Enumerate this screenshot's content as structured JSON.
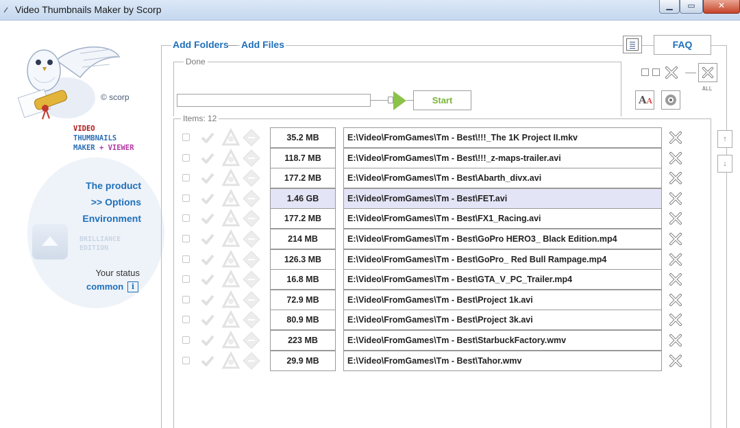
{
  "window": {
    "title": "Video Thumbnails Maker by Scorp"
  },
  "sidebar": {
    "copyright": "© scorp",
    "brand": {
      "line1": "VIDEO",
      "line2": "THUMBNAILS",
      "line3a": "MAKER",
      "line3b": "+",
      "line3c": "VIEWER"
    },
    "nav": [
      {
        "label": "The product"
      },
      {
        "label": ">> Options"
      },
      {
        "label": "Environment"
      }
    ],
    "edition": {
      "line1": "BRILLIANCE",
      "line2": "EDITION"
    },
    "status": {
      "label": "Your status",
      "value": "common"
    }
  },
  "toolbar": {
    "add_folders": "Add Folders",
    "add_files": "Add Files",
    "faq": "FAQ",
    "all_label": "ALL"
  },
  "progress": {
    "label": "Done",
    "value": 0,
    "start_button": "Start"
  },
  "items": {
    "label": "Items: 12",
    "rows": [
      {
        "size": "35.2 MB",
        "path": "E:\\Video\\FromGames\\Tm - Best\\!!!_The 1K Project II.mkv",
        "selected": false
      },
      {
        "size": "118.7 MB",
        "path": "E:\\Video\\FromGames\\Tm - Best\\!!!_z-maps-trailer.avi",
        "selected": false
      },
      {
        "size": "177.2 MB",
        "path": "E:\\Video\\FromGames\\Tm - Best\\Abarth_divx.avi",
        "selected": false
      },
      {
        "size": "1.46 GB",
        "path": "E:\\Video\\FromGames\\Tm - Best\\FET.avi",
        "selected": true
      },
      {
        "size": "177.2 MB",
        "path": "E:\\Video\\FromGames\\Tm - Best\\FX1_Racing.avi",
        "selected": false
      },
      {
        "size": "214 MB",
        "path": "E:\\Video\\FromGames\\Tm - Best\\GoPro HERO3_ Black Edition.mp4",
        "selected": false
      },
      {
        "size": "126.3 MB",
        "path": "E:\\Video\\FromGames\\Tm - Best\\GoPro_ Red Bull Rampage.mp4",
        "selected": false
      },
      {
        "size": "16.8 MB",
        "path": "E:\\Video\\FromGames\\Tm - Best\\GTA_V_PC_Trailer.mp4",
        "selected": false
      },
      {
        "size": "72.9 MB",
        "path": "E:\\Video\\FromGames\\Tm - Best\\Project 1k.avi",
        "selected": false
      },
      {
        "size": "80.9 MB",
        "path": "E:\\Video\\FromGames\\Tm - Best\\Project 3k.avi",
        "selected": false
      },
      {
        "size": "223 MB",
        "path": "E:\\Video\\FromGames\\Tm - Best\\StarbuckFactory.wmv",
        "selected": false
      },
      {
        "size": "29.9 MB",
        "path": "E:\\Video\\FromGames\\Tm - Best\\Tahor.wmv",
        "selected": false
      }
    ]
  },
  "colors": {
    "accent": "#1e6fba",
    "start_green": "#8bc34a",
    "selected_row": "#e4e4f7"
  }
}
